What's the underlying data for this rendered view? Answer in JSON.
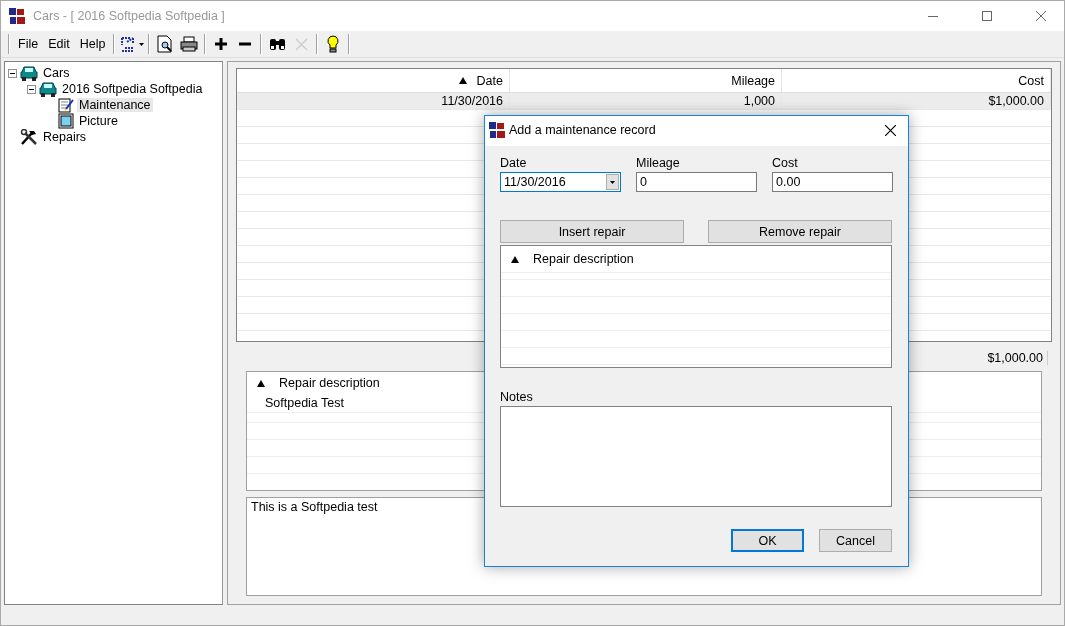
{
  "window": {
    "title": "Cars - [ 2016 Softpedia Softpedia ]"
  },
  "menu": [
    "File",
    "Edit",
    "Help"
  ],
  "toolbar": [
    {
      "kind": "wizard",
      "disabled": false
    },
    {
      "kind": "preview",
      "disabled": false
    },
    {
      "kind": "print",
      "disabled": false
    },
    {
      "kind": "add",
      "disabled": false
    },
    {
      "kind": "remove",
      "disabled": false
    },
    {
      "kind": "find",
      "disabled": false
    },
    {
      "kind": "delete",
      "disabled": true
    },
    {
      "kind": "help",
      "disabled": false
    }
  ],
  "tree": [
    {
      "label": "Cars",
      "kind": "car",
      "selected": false,
      "expanded": true,
      "children": [
        {
          "label": "2016 Softpedia Softpedia",
          "kind": "car",
          "selected": false,
          "expanded": true,
          "children": [
            {
              "label": "Maintenance",
              "kind": "record",
              "selected": true
            },
            {
              "label": "Picture",
              "kind": "picture",
              "selected": false
            }
          ]
        }
      ]
    },
    {
      "label": "Repairs",
      "kind": "tools",
      "selected": false
    }
  ],
  "table": {
    "columns": [
      {
        "label": "Date",
        "sorted": true
      },
      {
        "label": "Mileage",
        "sorted": false
      },
      {
        "label": "Cost",
        "sorted": false
      }
    ],
    "rows": [
      {
        "cells": [
          "11/30/2016",
          "1,000",
          "$1,000.00"
        ],
        "selected": true
      }
    ]
  },
  "total": "$1,000.00",
  "repairs": {
    "column": "Repair description",
    "rows": [
      "Softpedia Test"
    ]
  },
  "notes": "This is a Softpedia test",
  "dialog": {
    "title": "Add a maintenance record",
    "fields": [
      {
        "label": "Date",
        "value": "11/30/2016",
        "kind": "dropdown",
        "focused": true
      },
      {
        "label": "Mileage",
        "value": "0",
        "kind": "text",
        "focused": false
      },
      {
        "label": "Cost",
        "value": "0.00",
        "kind": "text",
        "focused": false
      }
    ],
    "buttons": [
      "Insert repair",
      "Remove repair"
    ],
    "repairs": {
      "column": "Repair description"
    },
    "notes_label": "Notes",
    "actions": [
      {
        "label": "OK",
        "default": true
      },
      {
        "label": "Cancel",
        "default": false
      }
    ]
  }
}
